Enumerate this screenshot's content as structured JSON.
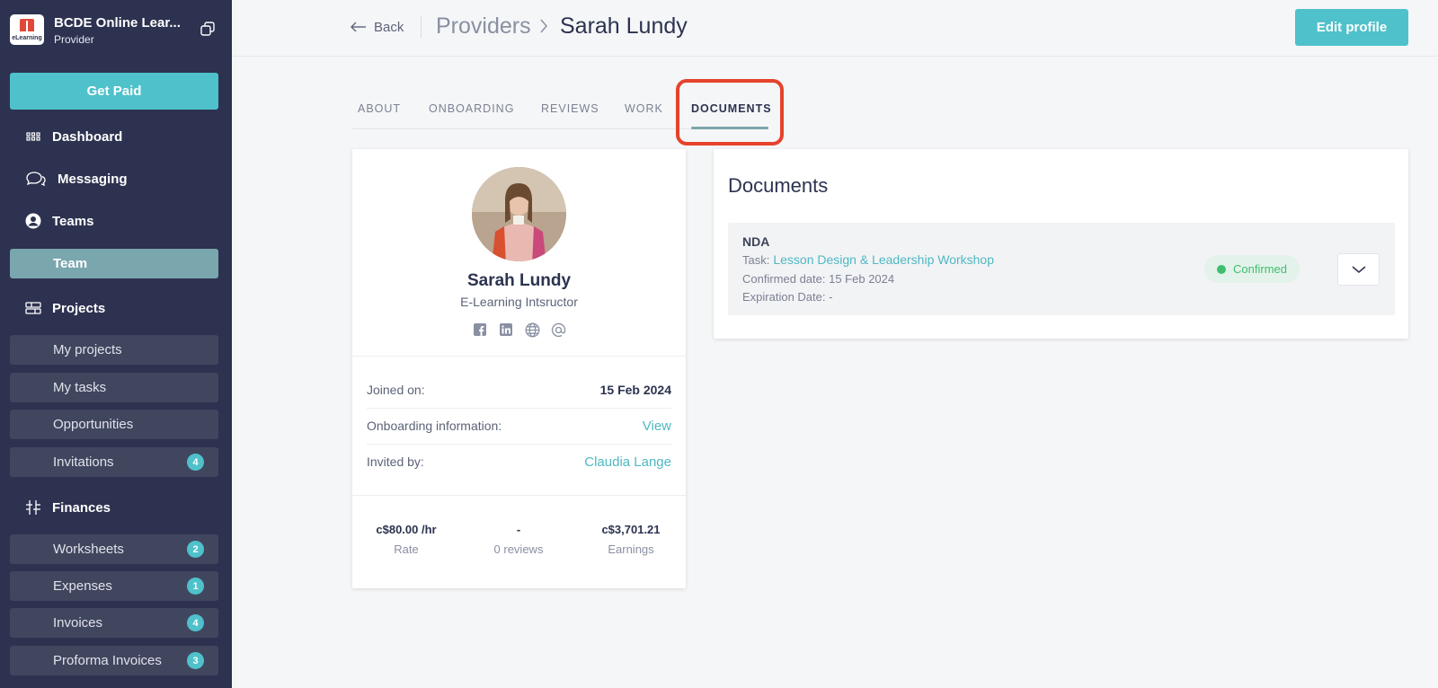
{
  "sidebar": {
    "brand": {
      "name": "BCDE Online Lear...",
      "role": "Provider",
      "logo_text": "eLearning"
    },
    "get_paid": "Get Paid",
    "sections": {
      "dashboard": "Dashboard",
      "messaging": "Messaging",
      "teams": "Teams",
      "projects": "Projects",
      "finances": "Finances"
    },
    "teams_items": [
      {
        "label": "Team"
      }
    ],
    "projects_items": [
      {
        "label": "My projects"
      },
      {
        "label": "My tasks"
      },
      {
        "label": "Opportunities"
      },
      {
        "label": "Invitations",
        "badge": "4"
      }
    ],
    "finances_items": [
      {
        "label": "Worksheets",
        "badge": "2"
      },
      {
        "label": "Expenses",
        "badge": "1"
      },
      {
        "label": "Invoices",
        "badge": "4"
      },
      {
        "label": "Proforma Invoices",
        "badge": "3"
      }
    ]
  },
  "topbar": {
    "back": "Back",
    "breadcrumb_parent": "Providers",
    "breadcrumb_current": "Sarah Lundy",
    "edit_profile": "Edit profile"
  },
  "tabs": [
    {
      "label": "ABOUT"
    },
    {
      "label": "ONBOARDING"
    },
    {
      "label": "REVIEWS"
    },
    {
      "label": "WORK"
    },
    {
      "label": "DOCUMENTS",
      "active": true
    }
  ],
  "profile": {
    "name": "Sarah Lundy",
    "title": "E-Learning Intsructor",
    "rows": {
      "joined_label": "Joined on:",
      "joined_value": "15 Feb 2024",
      "onboarding_label": "Onboarding information:",
      "onboarding_link": "View",
      "invited_label": "Invited by:",
      "invited_link": "Claudia Lange"
    },
    "stats": {
      "rate_value": "c$80.00 /hr",
      "rate_label": "Rate",
      "reviews_value": "-",
      "reviews_label": "0 reviews",
      "earnings_value": "c$3,701.21",
      "earnings_label": "Earnings"
    }
  },
  "documents": {
    "title": "Documents",
    "item": {
      "name": "NDA",
      "task_label": "Task:",
      "task_link": "Lesson Design & Leadership Workshop",
      "confirmed": "Confirmed date: 15 Feb 2024",
      "expiration": "Expiration Date: -",
      "status": "Confirmed"
    }
  },
  "colors": {
    "accent": "#4fc1cb",
    "sidebar": "#2d3250",
    "active_nav": "#7aa6ad",
    "highlight": "#e5432d",
    "success": "#3fbf6d"
  }
}
